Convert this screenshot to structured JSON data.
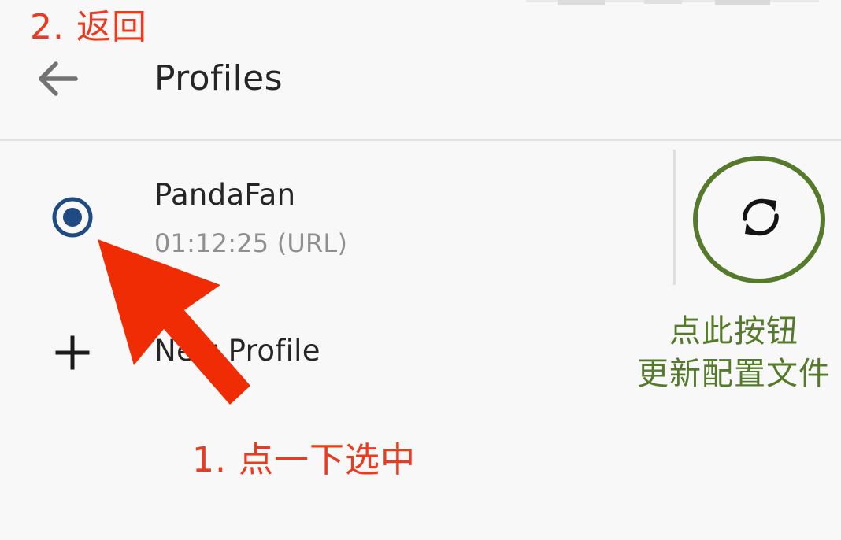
{
  "app_bar": {
    "title": "Profiles",
    "back_icon": "arrow-left-icon"
  },
  "profile": {
    "name": "PandaFan",
    "meta": "01:12:25 (URL)",
    "selected": true,
    "radio_color": "#1f4a82",
    "update_icon": "sync-icon"
  },
  "new_profile": {
    "label": "New Profile",
    "icon": "plus-icon"
  },
  "annotations": {
    "back": "2. 返回",
    "select": "1. 点一下选中",
    "update_line1": "点此按钮",
    "update_line2": "更新配置文件"
  },
  "colors": {
    "background": "#f8f8f8",
    "annotation_red": "#ea3b21",
    "annotation_green": "#557a2b",
    "highlight_circle": "#557a2b",
    "meta_text": "#8f8f8f"
  }
}
